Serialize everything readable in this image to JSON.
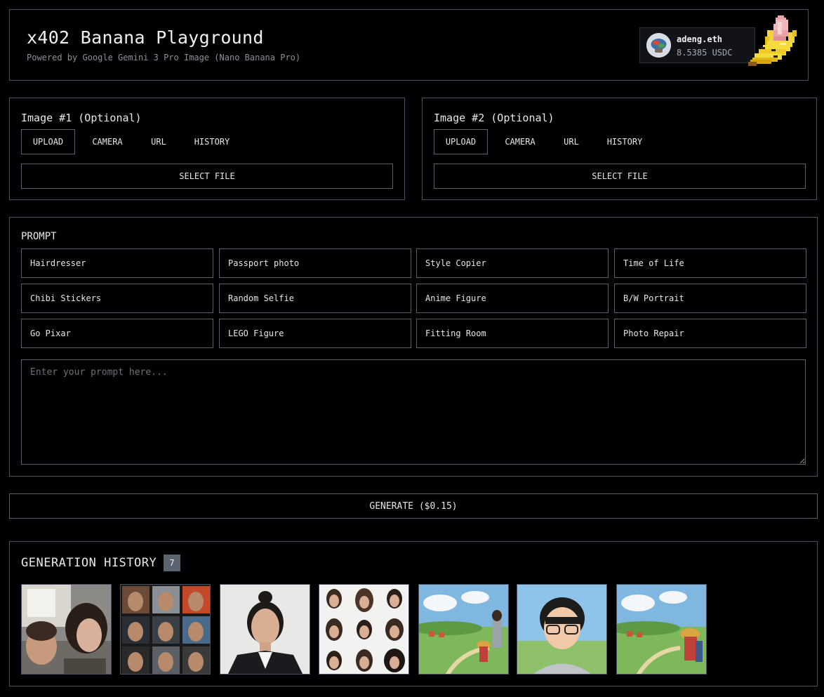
{
  "header": {
    "title": "x402 Banana Playground",
    "subtitle": "Powered by Google Gemini 3 Pro Image (Nano Banana Pro)",
    "wallet": {
      "name": "adeng.eth",
      "balance": "8.5385 USDC",
      "avatar_icon": "wallet-avatar-icon"
    },
    "logo_icon": "banana-icon"
  },
  "image_panels": [
    {
      "title": "Image #1 (Optional)",
      "tabs": [
        "UPLOAD",
        "CAMERA",
        "URL",
        "HISTORY"
      ],
      "active_tab": "UPLOAD",
      "select_file": "SELECT FILE"
    },
    {
      "title": "Image #2 (Optional)",
      "tabs": [
        "UPLOAD",
        "CAMERA",
        "URL",
        "HISTORY"
      ],
      "active_tab": "UPLOAD",
      "select_file": "SELECT FILE"
    }
  ],
  "prompt": {
    "heading": "PROMPT",
    "presets": [
      "Hairdresser",
      "Passport photo",
      "Style Copier",
      "Time of Life",
      "Chibi Stickers",
      "Random Selfie",
      "Anime Figure",
      "B/W Portrait",
      "Go Pixar",
      "LEGO Figure",
      "Fitting Room",
      "Photo Repair"
    ],
    "placeholder": "Enter your prompt here...",
    "value": ""
  },
  "generate": {
    "label": "GENERATE ($0.15)"
  },
  "history": {
    "title": "GENERATION HISTORY",
    "count": "7",
    "items": [
      {
        "kind": "selfie-photo"
      },
      {
        "kind": "hairstyle-grid-men"
      },
      {
        "kind": "passport-photo"
      },
      {
        "kind": "hairstyle-grid-women"
      },
      {
        "kind": "anime-landscape"
      },
      {
        "kind": "anime-portrait"
      },
      {
        "kind": "anime-landscape"
      }
    ]
  },
  "colors": {
    "background": "#000000",
    "border": "#4b5160",
    "text": "#e6e6e6",
    "muted": "#8a8f99",
    "badge": "#5b6270"
  }
}
